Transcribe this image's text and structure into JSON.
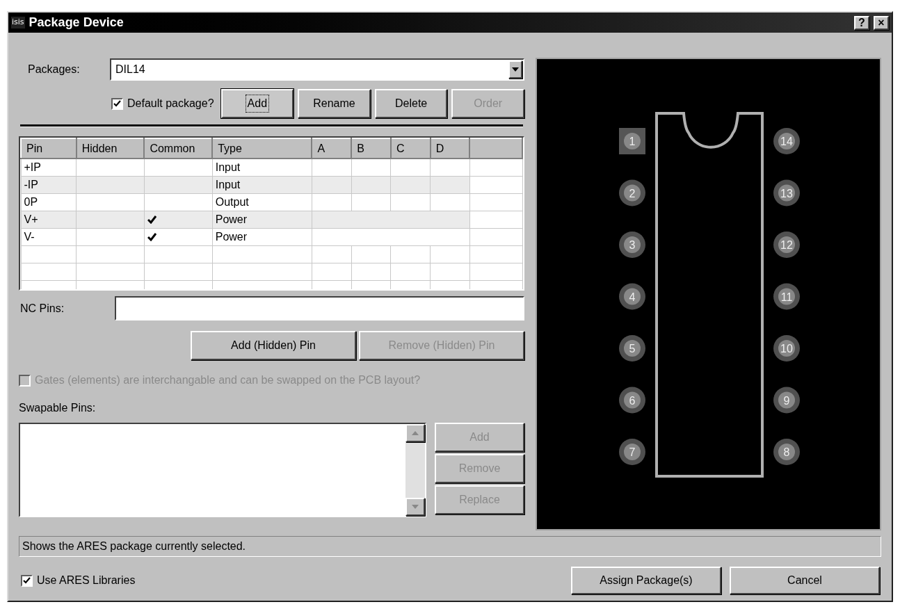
{
  "window": {
    "icon_text": "isis",
    "title": "Package Device",
    "help_button": "?",
    "close_button": "×"
  },
  "packages": {
    "label": "Packages:",
    "value": "DIL14"
  },
  "default_package": {
    "label": "Default package?",
    "checked": true
  },
  "package_buttons": [
    {
      "label": "Add",
      "disabled": false,
      "focused": true
    },
    {
      "label": "Rename",
      "disabled": false,
      "focused": false
    },
    {
      "label": "Delete",
      "disabled": false,
      "focused": false
    },
    {
      "label": "Order",
      "disabled": true,
      "focused": false
    }
  ],
  "table": {
    "columns": [
      "Pin",
      "Hidden",
      "Common",
      "Type",
      "A",
      "B",
      "C",
      "D"
    ],
    "rows": [
      {
        "pin": "+IP",
        "common": false,
        "type": "Input",
        "merged": false
      },
      {
        "pin": "-IP",
        "common": false,
        "type": "Input",
        "merged": false
      },
      {
        "pin": "0P",
        "common": false,
        "type": "Output",
        "merged": false
      },
      {
        "pin": "V+",
        "common": true,
        "type": "Power",
        "merged": true
      },
      {
        "pin": "V-",
        "common": true,
        "type": "Power",
        "merged": true
      }
    ]
  },
  "nc_pins": {
    "label": "NC Pins:"
  },
  "pin_buttons": [
    {
      "label": "Add (Hidden) Pin",
      "disabled": false
    },
    {
      "label": "Remove (Hidden) Pin",
      "disabled": true
    }
  ],
  "gates": {
    "label": "Gates (elements) are interchangable and can be swapped on the PCB layout?",
    "checked": false,
    "disabled": true
  },
  "swapable_pins": {
    "label": "Swapable Pins:",
    "buttons": [
      {
        "label": "Add",
        "disabled": true
      },
      {
        "label": "Remove",
        "disabled": true
      },
      {
        "label": "Replace",
        "disabled": true
      }
    ]
  },
  "preview": {
    "pins": [
      {
        "label": "1",
        "selected": true
      },
      {
        "label": "14",
        "selected": false
      },
      {
        "label": "2",
        "selected": false
      },
      {
        "label": "13",
        "selected": false
      },
      {
        "label": "3",
        "selected": false
      },
      {
        "label": "12",
        "selected": false
      },
      {
        "label": "4",
        "selected": false
      },
      {
        "label": "11",
        "selected": false
      },
      {
        "label": "5",
        "selected": false
      },
      {
        "label": "10",
        "selected": false
      },
      {
        "label": "6",
        "selected": false
      },
      {
        "label": "9",
        "selected": false
      },
      {
        "label": "7",
        "selected": false
      },
      {
        "label": "8",
        "selected": false
      }
    ]
  },
  "status_bar": "Shows the ARES package currently selected.",
  "use_ares": {
    "label": "Use ARES Libraries",
    "checked": true
  },
  "footer_buttons": [
    "Assign Package(s)",
    "Cancel"
  ]
}
